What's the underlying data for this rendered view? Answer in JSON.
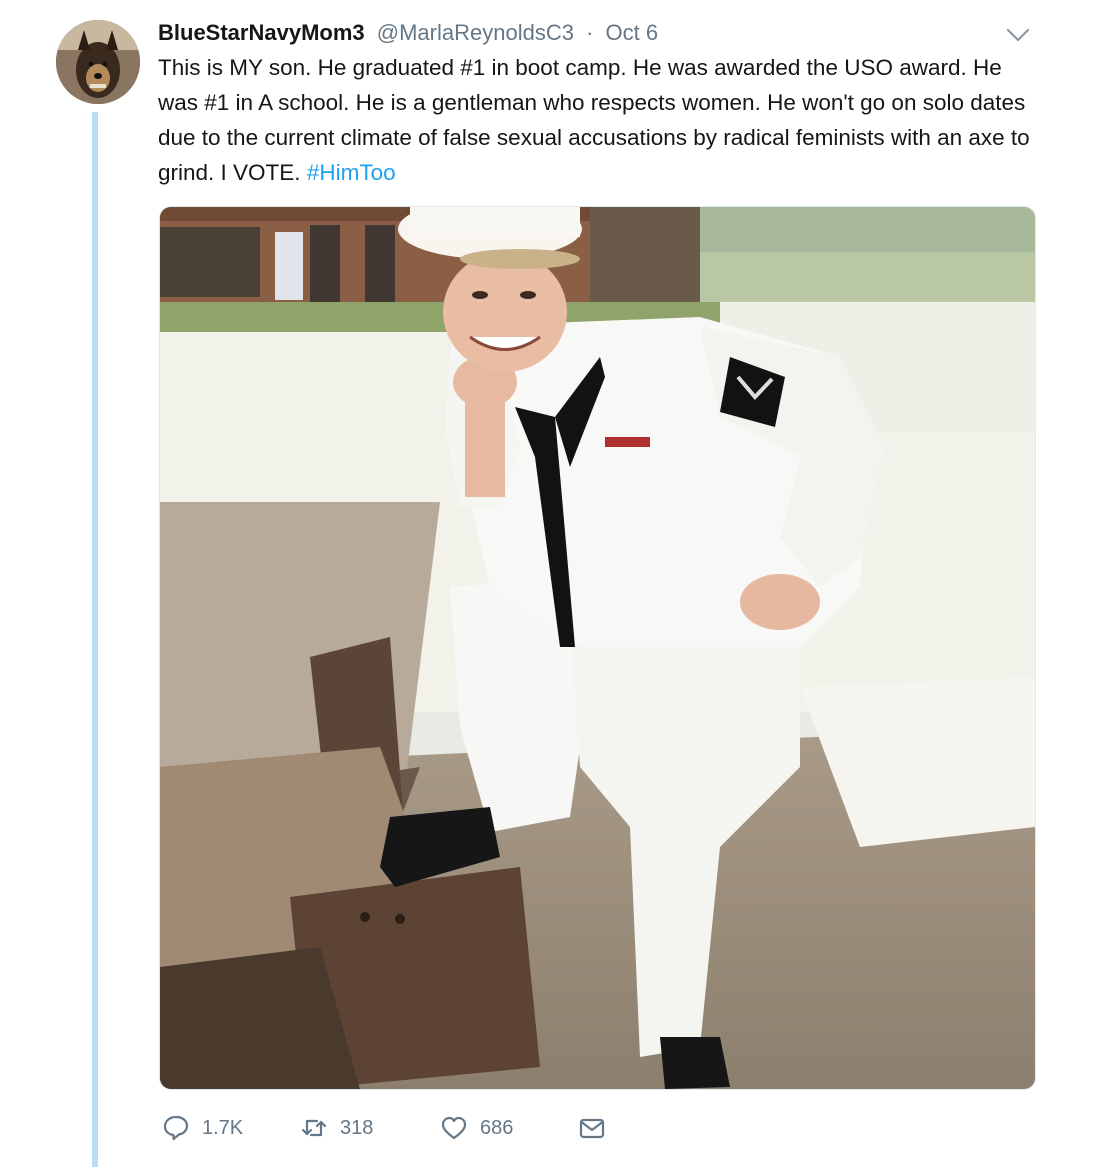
{
  "tweet": {
    "display_name": "BlueStarNavyMom3",
    "handle": "@MarlaReynoldsC3",
    "separator": "·",
    "date": "Oct 6",
    "text": "This is MY son. He graduated #1 in boot camp. He was awarded the USO award. He was #1 in A school. He is a gentleman who respects women. He won't go on solo dates due to the current climate of false sexual accusations by radical feminists with an axe to grind. I VOTE. ",
    "hashtag": "#HimToo"
  },
  "actions": {
    "reply_count": "1.7K",
    "retweet_count": "318",
    "like_count": "686"
  },
  "icons": {
    "avatar": "dog-avatar",
    "menu": "chevron-down-icon",
    "reply": "reply-icon",
    "retweet": "retweet-icon",
    "like": "heart-icon",
    "dm": "envelope-icon"
  },
  "colors": {
    "link": "#1da1f2",
    "muted": "#657786",
    "thread_line": "#b7dcf5"
  }
}
